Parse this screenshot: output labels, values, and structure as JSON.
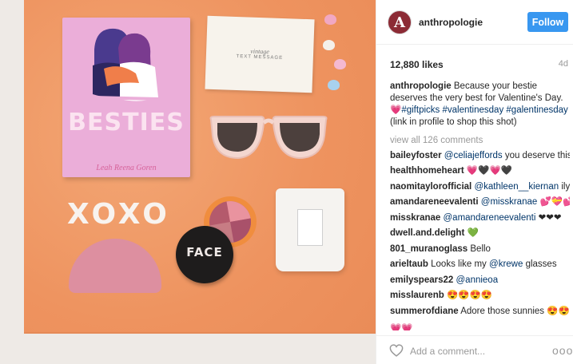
{
  "header": {
    "avatar_letter": "A",
    "username": "anthropologie",
    "follow_label": "Follow"
  },
  "stats": {
    "likes": "12,880 likes",
    "time_ago": "4d"
  },
  "caption": {
    "username": "anthropologie",
    "text": "Because your bestie deserves the very best for Valentine's Day.",
    "emoji": "💗",
    "tags": [
      "#giftpicks",
      "#valentinesday",
      "#galentinesday"
    ],
    "suffix": "(link in profile to shop this shot)"
  },
  "view_all": "view all 126 comments",
  "comments": [
    {
      "user": "baileyfoster",
      "mention": "@celiajeffords",
      "text": "you deserve this"
    },
    {
      "user": "healthhomeheart",
      "mention": "",
      "text": "💗🖤💗🖤"
    },
    {
      "user": "naomitaylorofficial",
      "mention": "@kathleen__kiernan",
      "text": "ily"
    },
    {
      "user": "amandareneevalenti",
      "mention": "@misskranae",
      "text": "💕💝💕"
    },
    {
      "user": "misskranae",
      "mention": "@amandareneevalenti",
      "text": "❤❤❤"
    },
    {
      "user": "dwell.and.delight",
      "mention": "",
      "text": "💚"
    },
    {
      "user": "801_muranoglass",
      "mention": "",
      "text": "Bello"
    },
    {
      "user": "arieltaub",
      "mention": "",
      "text": "Looks like my",
      "mention2": "@krewe",
      "text2": "glasses"
    },
    {
      "user": "emilyspears22",
      "mention": "@annieoa",
      "text": ""
    },
    {
      "user": "misslaurenb",
      "mention": "",
      "text": "😍😍😍😍"
    },
    {
      "user": "summerofdiane",
      "mention": "",
      "text": "Adore those sunnies 😍😍"
    }
  ],
  "truncated_comment": "💗💗",
  "footer": {
    "add_comment_placeholder": "Add a comment...",
    "more_label": "ooo"
  },
  "photo": {
    "book_title": "BESTIES",
    "book_author": "Leah Reena Goren",
    "card_line1": "vintage",
    "card_line2": "TEXT MESSAGE",
    "compact_brand": "FACE",
    "xoxo": "XOXO"
  },
  "colors": {
    "follow_button": "#3897f0",
    "hashtag": "#003569",
    "background_paper": "#f09a68"
  },
  "icons": [
    "heart-icon",
    "more-options-icon"
  ]
}
